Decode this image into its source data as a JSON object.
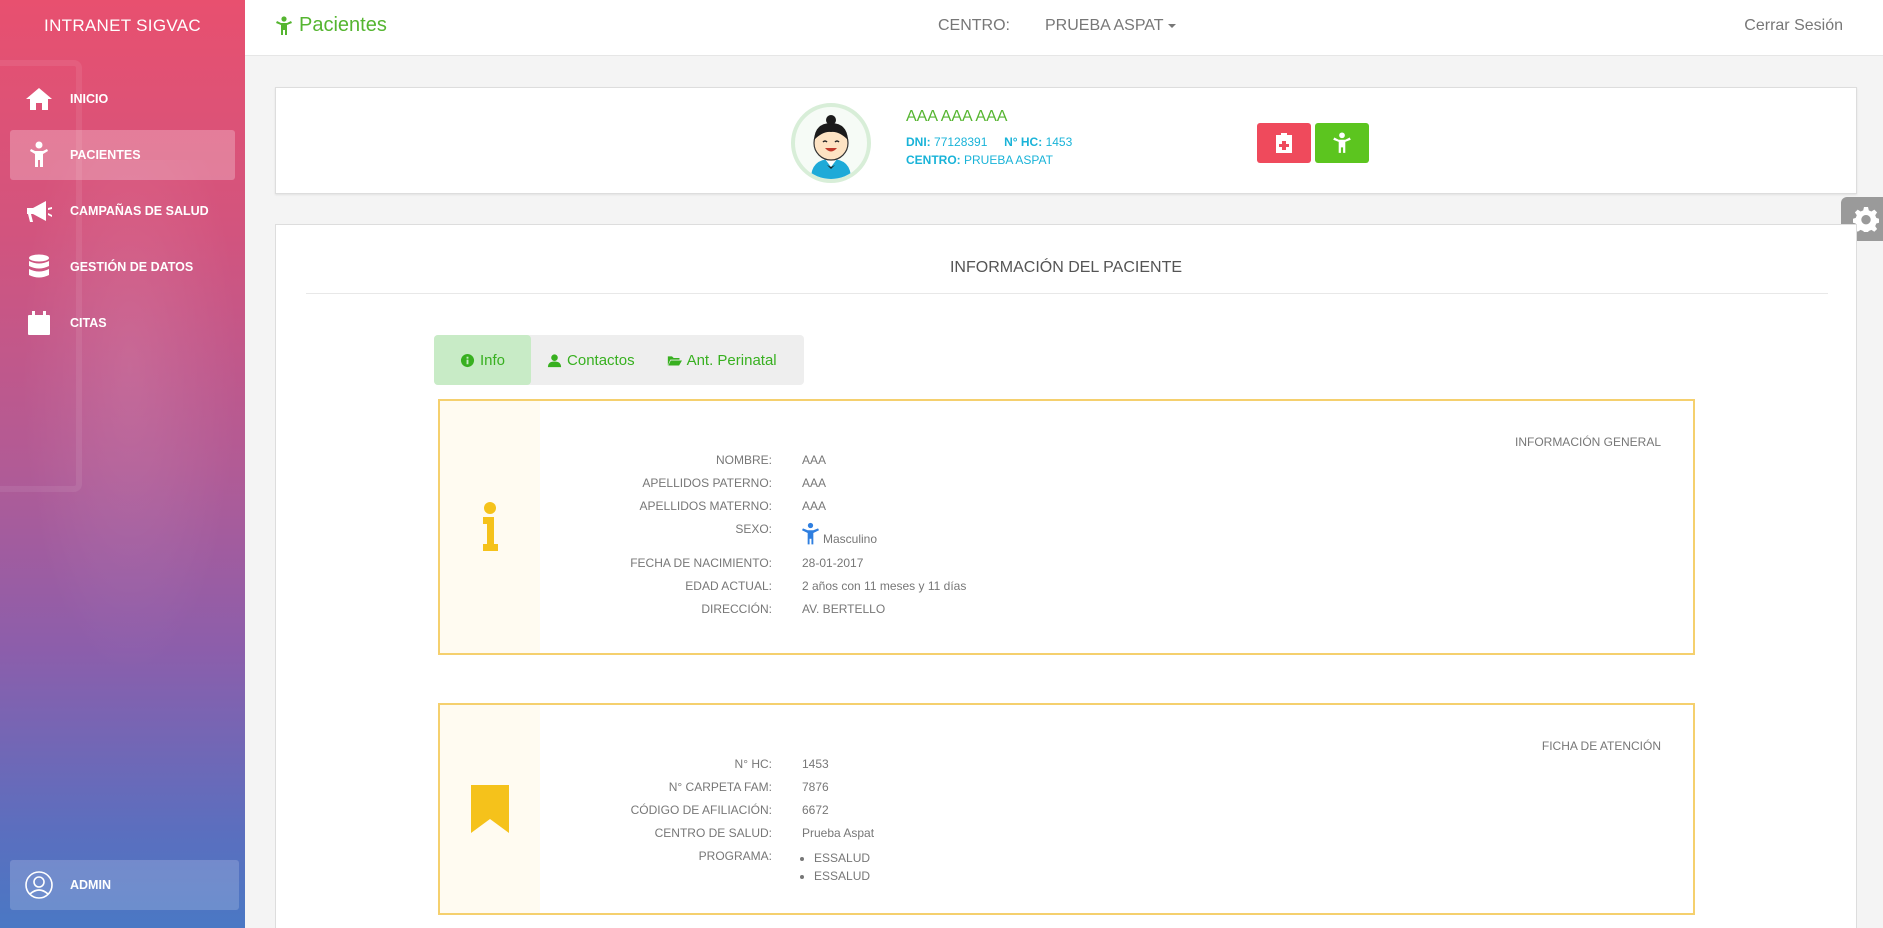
{
  "sidebar": {
    "brand": "INTRANET SIGVAC",
    "items": [
      {
        "label": "INICIO",
        "icon": "home-icon"
      },
      {
        "label": "PACIENTES",
        "icon": "child-icon"
      },
      {
        "label": "CAMPAÑAS DE SALUD",
        "icon": "megaphone-icon"
      },
      {
        "label": "GESTIÓN DE DATOS",
        "icon": "database-icon"
      },
      {
        "label": "CITAS",
        "icon": "calendar-icon"
      }
    ],
    "user": "ADMIN"
  },
  "topbar": {
    "title": "Pacientes",
    "centro_label": "CENTRO:",
    "centro_value": "PRUEBA ASPAT",
    "logout": "Cerrar Sesión"
  },
  "patient": {
    "name": "AAA AAA AAA",
    "dni_label": "DNI:",
    "dni": "77128391",
    "hc_label": "N° HC:",
    "hc": "1453",
    "centro_label": "CENTRO:",
    "centro": "PRUEBA ASPAT"
  },
  "main": {
    "title": "INFORMACIÓN DEL PACIENTE",
    "tabs": [
      {
        "label": "Info",
        "icon": "info-circle-icon"
      },
      {
        "label": "Contactos",
        "icon": "user-icon"
      },
      {
        "label": "Ant. Perinatal",
        "icon": "folder-open-icon"
      }
    ],
    "general": {
      "heading": "INFORMACIÓN GENERAL",
      "rows": [
        {
          "label": "NOMBRE:",
          "value": "AAA"
        },
        {
          "label": "APELLIDOS PATERNO:",
          "value": "AAA"
        },
        {
          "label": "APELLIDOS MATERNO:",
          "value": "AAA"
        },
        {
          "label": "SEXO:",
          "value": "Masculino"
        },
        {
          "label": "FECHA DE NACIMIENTO:",
          "value": "28-01-2017"
        },
        {
          "label": "EDAD ACTUAL:",
          "value": "2 años con 11 meses y 11 días"
        },
        {
          "label": "DIRECCIÓN:",
          "value": "AV. BERTELLO"
        }
      ]
    },
    "ficha": {
      "heading": "FICHA DE ATENCIÓN",
      "rows": [
        {
          "label": "N° HC:",
          "value": "1453"
        },
        {
          "label": "N° CARPETA FAM:",
          "value": "7876"
        },
        {
          "label": "CÓDIGO DE AFILIACIÓN:",
          "value": "6672"
        },
        {
          "label": "CENTRO DE SALUD:",
          "value": "Prueba Aspat"
        }
      ],
      "programa_label": "PROGRAMA:",
      "programas": [
        "ESSALUD",
        "ESSALUD"
      ]
    }
  },
  "colors": {
    "accent_green": "#55b530",
    "info_cyan": "#19b3d8",
    "danger_red": "#ef4a5c",
    "warning_yellow": "#f5c21b",
    "male_blue": "#2f7fe0"
  }
}
